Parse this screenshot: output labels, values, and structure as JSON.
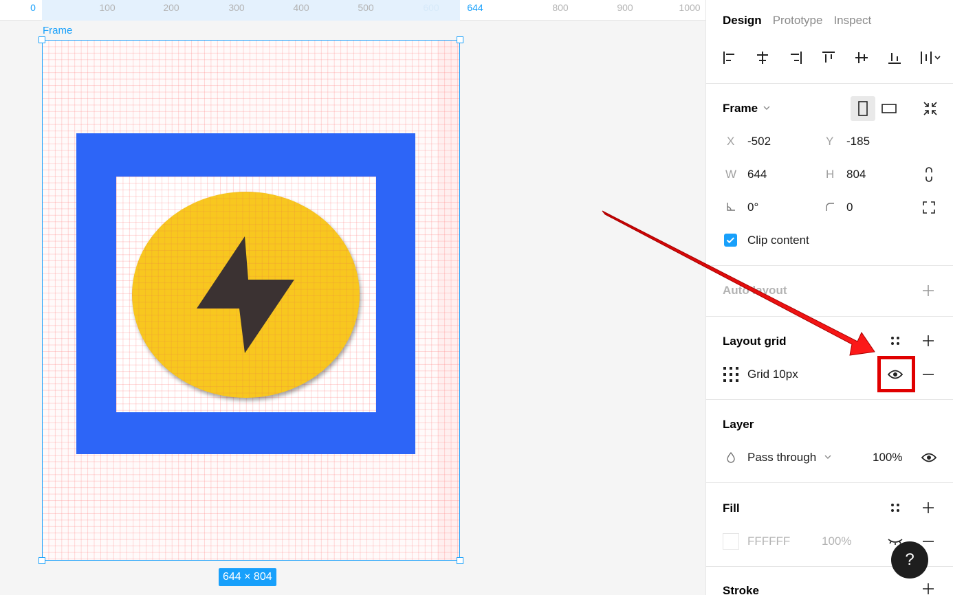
{
  "ruler": {
    "ticks": [
      "0",
      "100",
      "200",
      "300",
      "400",
      "500",
      "600",
      "644",
      "800",
      "900",
      "1000"
    ]
  },
  "canvas": {
    "frame_label": "Frame",
    "size_badge": "644 × 804"
  },
  "panel": {
    "tabs": [
      "Design",
      "Prototype",
      "Inspect"
    ],
    "frame": {
      "title": "Frame",
      "x_label": "X",
      "x_value": "-502",
      "y_label": "Y",
      "y_value": "-185",
      "w_label": "W",
      "w_value": "644",
      "h_label": "H",
      "h_value": "804",
      "rotation_value": "0°",
      "radius_value": "0",
      "clip_content_label": "Clip content"
    },
    "auto_layout": {
      "title": "Auto layout"
    },
    "layout_grid": {
      "title": "Layout grid",
      "item_label": "Grid 10px"
    },
    "layer": {
      "title": "Layer",
      "blend_mode": "Pass through",
      "opacity": "100%"
    },
    "fill": {
      "title": "Fill",
      "hex": "FFFFFF",
      "opacity": "100%"
    },
    "stroke": {
      "title": "Stroke"
    },
    "help": "?"
  },
  "colors": {
    "accent": "#18a0fb",
    "frame_blue": "#2d65f7",
    "circle_yellow": "#f8c71f",
    "bolt": "#3b3232",
    "annotation_red": "#e00000"
  }
}
